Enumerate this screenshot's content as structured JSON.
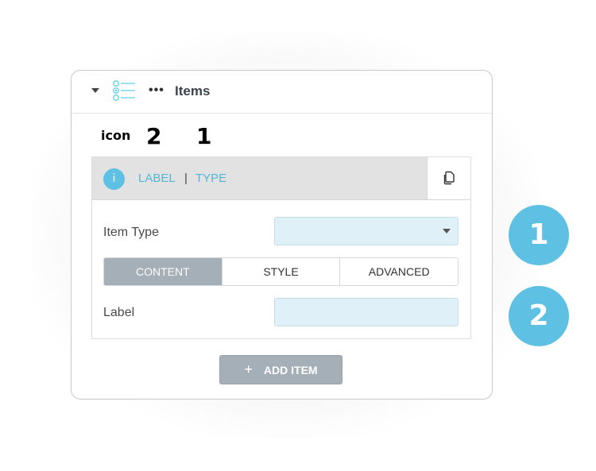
{
  "header": {
    "title": "Items",
    "more_label": "•••",
    "icons": [
      "caret-down-icon",
      "list-icon"
    ]
  },
  "markers": {
    "icon_label": "icon",
    "marker_2": "2",
    "marker_1": "1"
  },
  "item": {
    "info_icon_glyph": "i",
    "label": "LABEL",
    "separator": "|",
    "type": "TYPE",
    "copy_icon": "copy-icon",
    "fields": {
      "item_type_label": "Item Type",
      "item_type_value": "",
      "label_label": "Label",
      "label_value": ""
    },
    "tabs": [
      {
        "label": "CONTENT",
        "active": true
      },
      {
        "label": "STYLE",
        "active": false
      },
      {
        "label": "ADVANCED",
        "active": false
      }
    ]
  },
  "add_button": {
    "plus": "+",
    "label": "ADD ITEM"
  },
  "badges": [
    "1",
    "2"
  ],
  "colors": {
    "accent": "#5ec0e2",
    "active_tab": "#a4afb7",
    "input_bg": "#dff0f8"
  }
}
